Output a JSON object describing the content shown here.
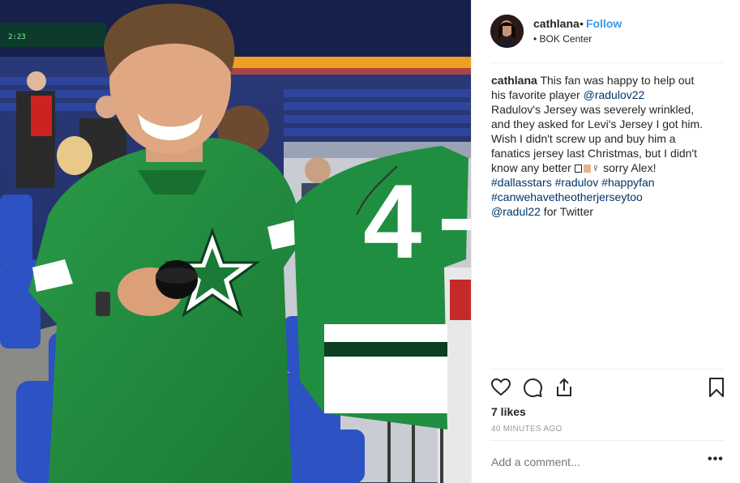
{
  "post": {
    "username": "cathlana",
    "follow_label": "Follow",
    "separator": "•",
    "location": "BOK Center",
    "photo_alt": "Fan in a green Dallas Stars jersey holding a hockey puck next to a signed number 4 jersey in an arena",
    "jersey_number": "4",
    "scoreboard_text": "2:23"
  },
  "caption": {
    "username": "cathlana",
    "line1": "This fan was happy to help out",
    "line2_text": "his favorite player ",
    "line2_mention": "@radulov22",
    "line3": "Radulov's Jersey was severely wrinkled,",
    "line4": "and they asked for Levi's Jersey I got him.",
    "line5": "Wish I didn't screw up and buy him a",
    "line6": "fanatics jersey last Christmas, but I didn't",
    "line7_text": "know any better ",
    "line7_emoji": "♀",
    "line7_tail": " sorry Alex!",
    "hashtags1": [
      "#dallasstars",
      "#radulov",
      "#happyfan"
    ],
    "hashtags2": "#canwehavetheotherjerseytoo",
    "last_mention": "@radul22",
    "last_text": " for Twitter"
  },
  "actions": {
    "like_icon": "heart-icon",
    "comment_icon": "comment-icon",
    "share_icon": "share-icon",
    "save_icon": "bookmark-icon"
  },
  "stats": {
    "likes": "7 likes",
    "time": "40 MINUTES AGO"
  },
  "comment": {
    "placeholder": "Add a comment...",
    "more": "•••"
  },
  "colors": {
    "link": "#3897f0",
    "hashtag": "#003569",
    "text": "#262626",
    "muted": "#999999",
    "stars_green": "#1f8a3c"
  }
}
